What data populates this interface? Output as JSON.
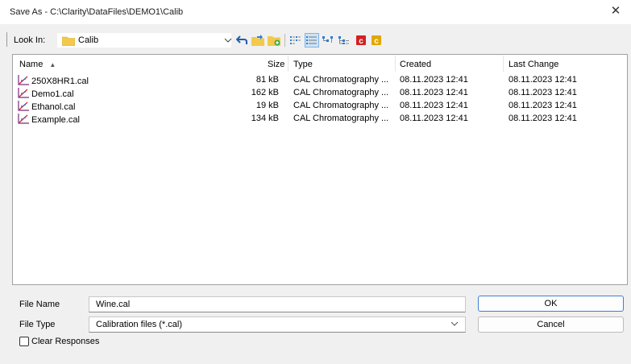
{
  "window": {
    "title": "Save As - C:\\Clarity\\DataFiles\\DEMO1\\Calib",
    "close_glyph": "✕"
  },
  "toolbar": {
    "look_in_label": "Look In:",
    "look_in_value": "Calib",
    "icons": [
      "up-folder-icon",
      "new-folder-icon",
      "new-folder-add-icon",
      "list-view-icon",
      "details-view-icon",
      "tree-view-icon",
      "tree-view-alt-icon",
      "calibration-red-icon",
      "calibration-yellow-icon"
    ]
  },
  "columns": {
    "name": "Name",
    "size": "Size",
    "type": "Type",
    "created": "Created",
    "last_change": "Last Change",
    "sort_glyph": "▲"
  },
  "files": [
    {
      "name": "250X8HR1.cal",
      "size": "81 kB",
      "type": "CAL Chromatography ...",
      "created": "08.11.2023 12:41",
      "last_change": "08.11.2023 12:41"
    },
    {
      "name": "Demo1.cal",
      "size": "162 kB",
      "type": "CAL Chromatography ...",
      "created": "08.11.2023 12:41",
      "last_change": "08.11.2023 12:41"
    },
    {
      "name": "Ethanol.cal",
      "size": "19 kB",
      "type": "CAL Chromatography ...",
      "created": "08.11.2023 12:41",
      "last_change": "08.11.2023 12:41"
    },
    {
      "name": "Example.cal",
      "size": "134 kB",
      "type": "CAL Chromatography ...",
      "created": "08.11.2023 12:41",
      "last_change": "08.11.2023 12:41"
    }
  ],
  "form": {
    "file_name_label": "File Name",
    "file_name_value": "Wine.cal",
    "file_type_label": "File Type",
    "file_type_value": "Calibration files (*.cal)",
    "clear_responses_label": "Clear Responses",
    "clear_responses_checked": false
  },
  "buttons": {
    "ok": "OK",
    "cancel": "Cancel"
  },
  "colors": {
    "accent": "#3d7fd6",
    "folder": "#f2c94c",
    "calib_red": "#d42020",
    "calib_yellow": "#e0a800"
  }
}
